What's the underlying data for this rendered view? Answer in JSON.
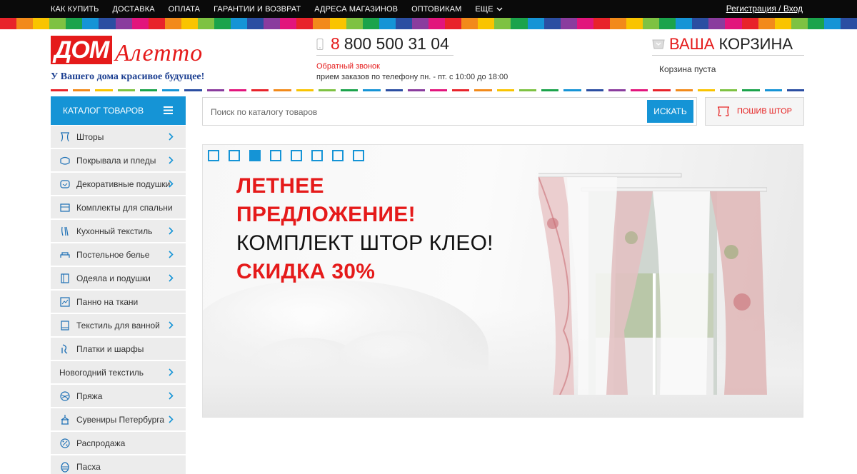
{
  "topnav": {
    "items": [
      "КАК КУПИТЬ",
      "ДОСТАВКА",
      "ОПЛАТА",
      "ГАРАНТИИ И ВОЗВРАТ",
      "АДРЕСА МАГАЗИНОВ",
      "ОПТОВИКАМ",
      "ЕЩЕ"
    ],
    "auth": "Регистрация / Вход"
  },
  "logo": {
    "brand_main": "ДОМ",
    "brand_script": "Алетто",
    "tagline": "У Вашего дома красивое будущее!"
  },
  "contact": {
    "phone_code": "8",
    "phone_number": "800 500 31 04",
    "callback": "Обратный звонок",
    "hours": "прием заказов по телефону пн. - пт. с 10:00 до 18:00"
  },
  "cart": {
    "title_red": "ВАША",
    "title_black": "КОРЗИНА",
    "status": "Корзина пуста"
  },
  "catalog": {
    "header": "КАТАЛОГ ТОВАРОВ",
    "items": [
      {
        "label": "Шторы",
        "icon": "curtain-icon",
        "arrow": true
      },
      {
        "label": "Покрывала и пледы",
        "icon": "blanket-icon",
        "arrow": true
      },
      {
        "label": "Декоративные подушки",
        "icon": "pillow-icon",
        "arrow": true
      },
      {
        "label": "Комплекты для спальни",
        "icon": "bedroom-set-icon",
        "arrow": false
      },
      {
        "label": "Кухонный текстиль",
        "icon": "kitchen-icon",
        "arrow": true
      },
      {
        "label": "Постельное белье",
        "icon": "bed-linen-icon",
        "arrow": true
      },
      {
        "label": "Одеяла и подушки",
        "icon": "duvet-icon",
        "arrow": true
      },
      {
        "label": "Панно на ткани",
        "icon": "panel-icon",
        "arrow": false
      },
      {
        "label": "Текстиль для ванной",
        "icon": "bath-icon",
        "arrow": true
      },
      {
        "label": "Платки и шарфы",
        "icon": "scarf-icon",
        "arrow": false
      },
      {
        "label": "Новогодний текстиль",
        "icon": "",
        "arrow": true
      },
      {
        "label": "Пряжа",
        "icon": "yarn-icon",
        "arrow": true
      },
      {
        "label": "Сувениры Петербурга",
        "icon": "souvenir-icon",
        "arrow": true
      },
      {
        "label": "Распродажа",
        "icon": "sale-icon",
        "arrow": false
      },
      {
        "label": "Пасха",
        "icon": "easter-egg-icon",
        "arrow": false
      }
    ]
  },
  "search": {
    "placeholder": "Поиск по каталогу товаров",
    "button": "ИСКАТЬ"
  },
  "tailoring": {
    "label": "ПОШИВ ШТОР"
  },
  "banner": {
    "line1": "ЛЕТНЕЕ",
    "line2": "ПРЕДЛОЖЕНИЕ!",
    "line3": "КОМПЛЕКТ ШТОР КЛЕО!",
    "line4": "СКИДКА 30%",
    "slides_total": 8,
    "active_slide": 3
  },
  "colors": {
    "accent_blue": "#1594d6",
    "brand_red": "#e51a1a",
    "rainbow": [
      "#e8232a",
      "#f28a1a",
      "#f9c400",
      "#7ec242",
      "#1ba34b",
      "#1594d6",
      "#2b4ea2",
      "#8a3c9e",
      "#e2157c"
    ]
  }
}
